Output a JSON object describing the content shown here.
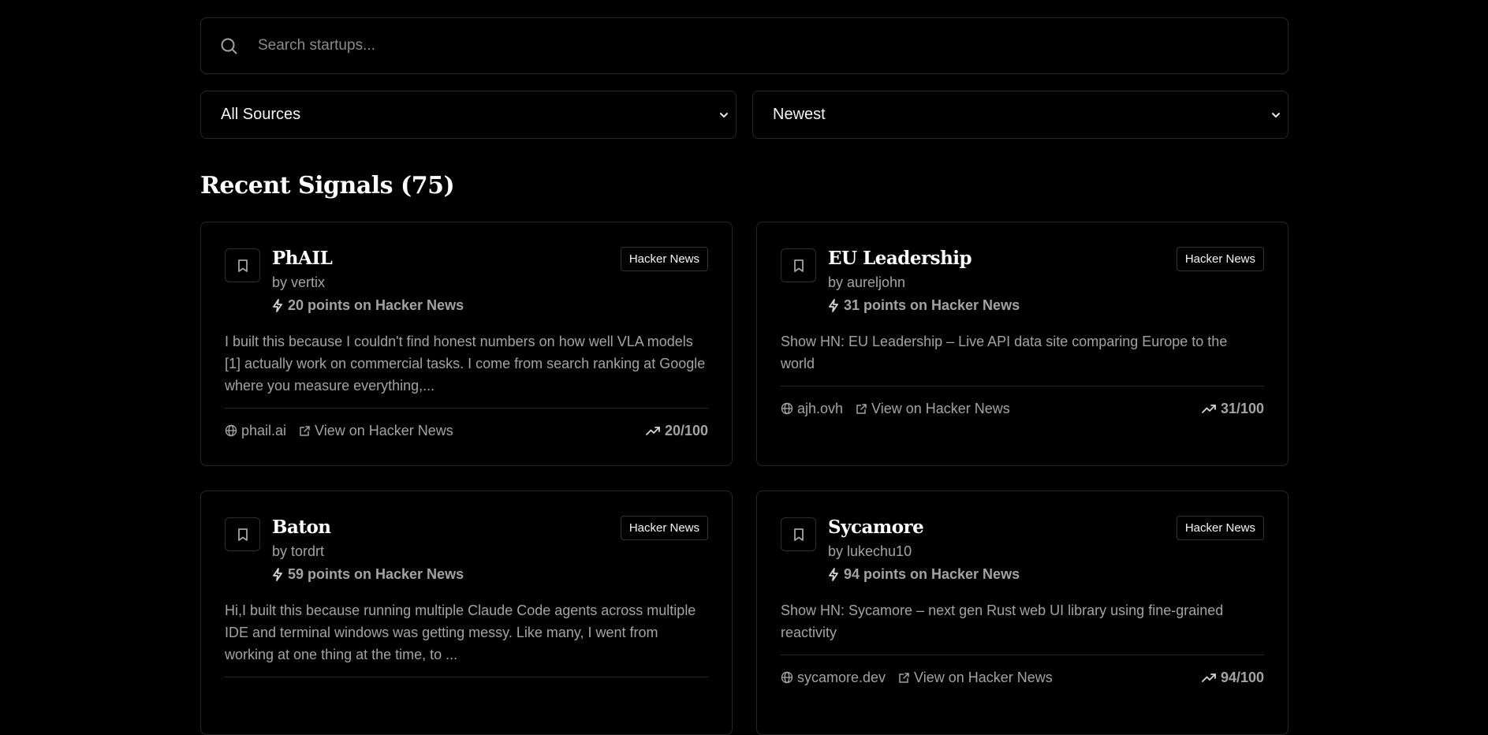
{
  "search": {
    "placeholder": "Search startups..."
  },
  "filters": {
    "source": "All Sources",
    "sort": "Newest"
  },
  "section": {
    "title": "Recent Signals (75)"
  },
  "cards": [
    {
      "title": "PhAIL",
      "author": "by vertix",
      "points": "20 points on Hacker News",
      "badge": "Hacker News",
      "description": "I built this because I couldn't find honest numbers on how well VLA models [1] actually work on commercial tasks. I come from search ranking at Google where you measure everything,...",
      "domain": "phail.ai",
      "link": "View on Hacker News",
      "score": "20/100"
    },
    {
      "title": "EU Leadership",
      "author": "by aureljohn",
      "points": "31 points on Hacker News",
      "badge": "Hacker News",
      "description": "Show HN: EU Leadership – Live API data site comparing Europe to the world",
      "domain": "ajh.ovh",
      "link": "View on Hacker News",
      "score": "31/100"
    },
    {
      "title": "Baton",
      "author": "by tordrt",
      "points": "59 points on Hacker News",
      "badge": "Hacker News",
      "description": "Hi,I built this because running multiple Claude Code agents across multiple IDE and terminal windows was getting messy. Like many, I went from working at one thing at the time, to ...",
      "domain": "",
      "link": "",
      "score": ""
    },
    {
      "title": "Sycamore",
      "author": "by lukechu10",
      "points": "94 points on Hacker News",
      "badge": "Hacker News",
      "description": "Show HN: Sycamore – next gen Rust web UI library using fine-grained reactivity",
      "domain": "sycamore.dev",
      "link": "View on Hacker News",
      "score": "94/100"
    }
  ]
}
